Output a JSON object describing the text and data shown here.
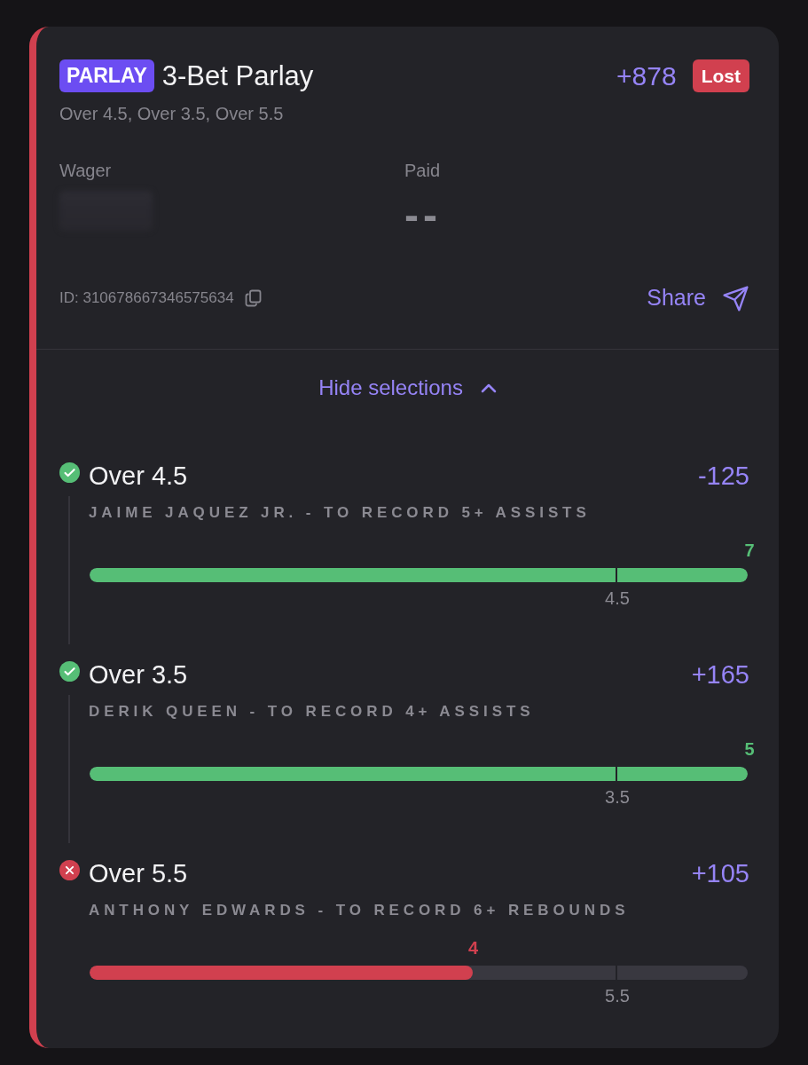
{
  "bet": {
    "type_badge": "PARLAY",
    "title": "3-Bet Parlay",
    "odds": "+878",
    "lost": true,
    "status_label": "Lost",
    "summary": "Over 4.5, Over 3.5, Over 5.5"
  },
  "stats": [
    {
      "label": "Wager",
      "blurred": true
    },
    {
      "label": "Paid",
      "value": "--"
    }
  ],
  "footer": {
    "id_text": "ID: 310678667346575634",
    "share_label": "Share"
  },
  "selections_toggle": {
    "label": "Hide selections",
    "expanded": true
  },
  "legs": [
    {
      "won": true,
      "title": "Over 4.5",
      "odds": "-125",
      "market": "JAIME JAQUEZ JR. - TO RECORD 5+ ASSISTS",
      "progress": {
        "level": 1,
        "reading": "7"
      },
      "marker": {
        "level": 0.8,
        "label": "4.5"
      }
    },
    {
      "won": true,
      "title": "Over 3.5",
      "odds": "+165",
      "market": "DERIK QUEEN - TO RECORD 4+ ASSISTS",
      "progress": {
        "level": 1,
        "reading": "5"
      },
      "marker": {
        "level": 0.8,
        "label": "3.5"
      }
    },
    {
      "won": false,
      "title": "Over 5.5",
      "odds": "+105",
      "market": "ANTHONY EDWARDS - TO RECORD 6+ REBOUNDS",
      "progress": {
        "level": 0.582,
        "reading": "4"
      },
      "marker": {
        "level": 0.8,
        "label": "5.5"
      }
    }
  ]
}
